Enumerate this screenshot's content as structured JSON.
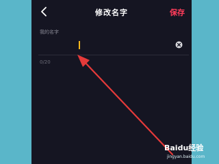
{
  "header": {
    "back_icon": "chevron-left-icon",
    "title": "修改名字",
    "save_label": "保存"
  },
  "form": {
    "label": "我的名字",
    "value": "",
    "counter": "0/20",
    "clear_icon": "clear-circle-icon"
  },
  "colors": {
    "background": "#5ab6c9",
    "screen": "#151522",
    "accent": "#ff3c5a",
    "caret": "#f7b81c",
    "annotation": "#e53a3a"
  },
  "watermark": {
    "brand": "Baidu经验",
    "url": "jingyan.baidu.com"
  }
}
